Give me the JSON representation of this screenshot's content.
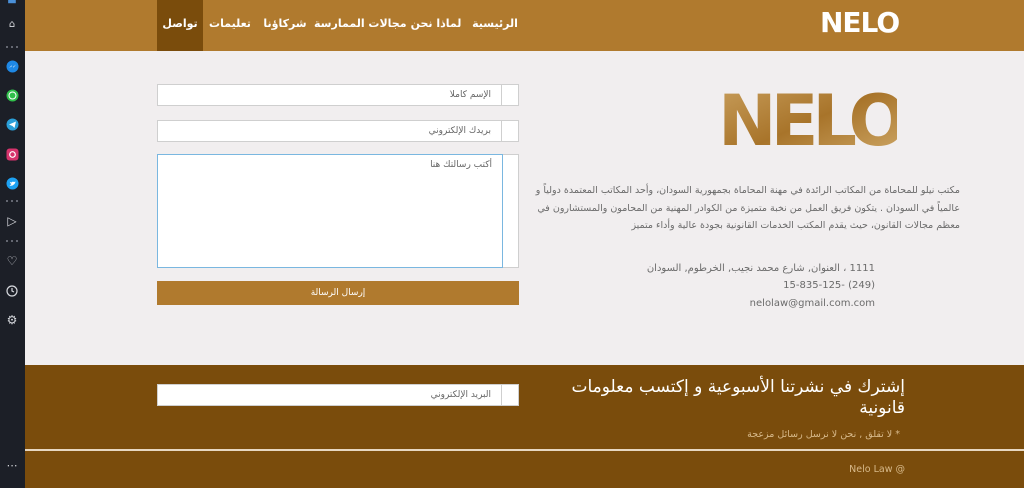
{
  "browser_sidebar": {
    "icons": [
      "home-icon",
      "messenger-icon",
      "whatsapp-icon",
      "telegram-icon",
      "instagram-icon",
      "twitter-icon",
      "send-icon",
      "heart-icon",
      "clock-icon",
      "gear-icon",
      "more-icon"
    ]
  },
  "header": {
    "logo": "NELO",
    "nav": [
      {
        "label": "الرئيسية"
      },
      {
        "label": "لماذا نحن"
      },
      {
        "label": "مجالات الممارسة"
      },
      {
        "label": "شركاؤنا"
      },
      {
        "label": "تعليمات"
      },
      {
        "label": "تواصل",
        "active": true
      }
    ]
  },
  "about": {
    "logo": "NELO",
    "text": "مكتب نيلو للمحاماة من المكاتب الرائدة في مهنة المحاماة بجمهورية السودان، وأحد المكاتب المعتمدة دولياً و عالمياً في السودان . يتكون فريق العمل من نخبة متميزة من الكوادر المهنية من المحامون والمستشارون في معظم مجالات القانون، حيث يقدم المكتب الخدمات القانونية بجودة عالية وأداء متميز",
    "address": "1111 ، العنوان, شارع محمد نجيب, الخرطوم, السودان",
    "phone": "(249) -15-835-125",
    "email": "nelolaw@gmail.com.com"
  },
  "form": {
    "name_placeholder": "الإسم كاملاً",
    "email_placeholder": "بريدك الإلكتروني",
    "message_placeholder": "أكتب رسالتك هنا",
    "send_label": "إرسال الرسالة"
  },
  "newsletter": {
    "title": "إشترك في نشرتنا الأسبوعية و إكتسب معلومات قانونية",
    "note": "* لا تقلق , نحن لا نرسل رسائل مزعجة",
    "email_placeholder": "البريد الإلكتروني"
  },
  "footer": {
    "copyright": "Nelo Law @"
  },
  "colors": {
    "brand": "#b07a2e",
    "brand_dark": "#7a4c0c",
    "background": "#f1eeef"
  }
}
